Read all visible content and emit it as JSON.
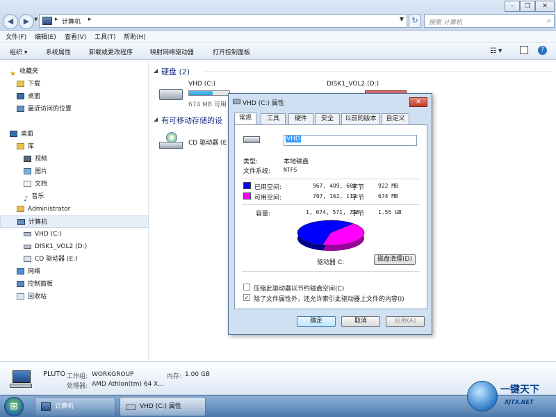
{
  "explorer": {
    "address": {
      "segment": "计算机"
    },
    "search": {
      "placeholder": "搜索 计算机"
    },
    "menu": [
      "文件(F)",
      "编辑(E)",
      "查看(V)",
      "工具(T)",
      "帮助(H)"
    ],
    "toolbar": [
      "组织",
      "系统属性",
      "卸载或更改程序",
      "映射网络驱动器",
      "打开控制面板"
    ],
    "nav": {
      "favorites": {
        "header": "收藏夹",
        "items": [
          "下载",
          "桌面",
          "最近访问的位置"
        ]
      },
      "desktop": "桌面",
      "library": {
        "header": "库",
        "items": [
          "视频",
          "图片",
          "文档",
          "音乐"
        ]
      },
      "administrator": "Administrator",
      "computer": {
        "header": "计算机",
        "items": [
          "VHD (C:)",
          "DISK1_VOL2 (D:)",
          "CD 驱动器 (E:)"
        ]
      },
      "network": "网络",
      "controlpanel": "控制面板",
      "recycle": "回收站"
    },
    "content": {
      "hdd_group": "硬盘 (2)",
      "removable_group": "有可移动存储的设",
      "drive_c": {
        "name": "VHD (C:)",
        "free": "674 MB 可用",
        "fill": 0.58
      },
      "drive_d": {
        "name": "DISK1_VOL2 (D:)"
      },
      "drive_e": {
        "name": "CD 驱动器 (E"
      }
    },
    "details": {
      "name": "PLUTO",
      "workgroup_label": "工作组:",
      "workgroup": "WORKGROUP",
      "memory_label": "内存:",
      "memory": "1.00 GB",
      "cpu_label": "处理器:",
      "cpu": "AMD Athlon(tm) 64 X..."
    },
    "taskbar": {
      "items": [
        "计算机",
        "VHD (C:) 属性"
      ]
    }
  },
  "dialog": {
    "title": "VHD (C:) 属性",
    "close": "✕",
    "tabs": [
      "常规",
      "工具",
      "硬件",
      "安全",
      "以前的版本",
      "自定义"
    ],
    "volume_name": "VHD",
    "type_label": "类型:",
    "type_value": "本地磁盘",
    "fs_label": "文件系统:",
    "fs_value": "NTFS",
    "used": {
      "label": "已用空间:",
      "bytes": "967, 409, 664",
      "unit": "字节",
      "size": "922 MB",
      "color": "#0000ff",
      "fraction": 0.578
    },
    "free": {
      "label": "可用空间:",
      "bytes": "707, 162, 112",
      "unit": "字节",
      "size": "674 MB",
      "color": "#ff00ff"
    },
    "capacity": {
      "label": "容量:",
      "bytes": "1, 674, 571, 776",
      "unit": "字节",
      "size": "1.55 GB"
    },
    "drive_label": "驱动器 C:",
    "cleanup_button": "磁盘清理(D)",
    "compress_label": "压缩此驱动器以节约磁盘空间(C)",
    "index_label": "除了文件属性外，还允许索引此驱动器上文件的内容(I)",
    "ok": "确定",
    "cancel": "取消",
    "apply": "应用(A)"
  },
  "watermark": {
    "text1": "一键天下",
    "text2": "XJTX.NET"
  }
}
